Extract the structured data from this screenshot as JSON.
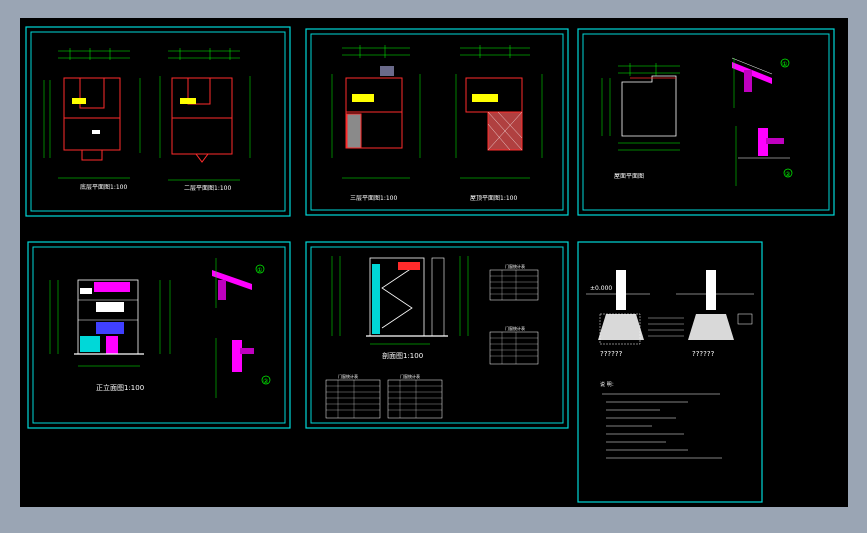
{
  "viewer": {
    "background_color": "#9aa5b4",
    "canvas_color": "#000000"
  },
  "colors": {
    "frame": "#00d8d8",
    "dimension": "#00ff00",
    "wall": "#ff2b2b",
    "text": "#ffffff",
    "accent": "#ff00ff",
    "yellow": "#ffff00",
    "blue": "#4040ff"
  },
  "sheets": [
    {
      "id": "sheet-1",
      "kind": "floor-plans",
      "captions": [
        "底层平面图1:100",
        "二层平面图1:100"
      ]
    },
    {
      "id": "sheet-2",
      "kind": "floor-plans",
      "captions": [
        "三层平面图1:100",
        "屋顶平面图1:100"
      ]
    },
    {
      "id": "sheet-3",
      "kind": "roof-plan-details",
      "captions": [
        "屋面平面图"
      ],
      "detail_markers": [
        "①",
        "②"
      ]
    },
    {
      "id": "sheet-4",
      "kind": "elevation",
      "captions": [
        "正立面图1:100"
      ],
      "detail_markers": [
        "①",
        "②"
      ]
    },
    {
      "id": "sheet-5",
      "kind": "section",
      "captions": [
        "剖面图1:100"
      ],
      "tables": [
        "门窗统计表",
        "门窗统计表",
        "门窗统计表",
        "门窗统计表"
      ]
    },
    {
      "id": "sheet-6",
      "kind": "foundation-notes",
      "labels": [
        "±0.000",
        "??????",
        "??????"
      ],
      "notes_title": "说 明："
    }
  ]
}
